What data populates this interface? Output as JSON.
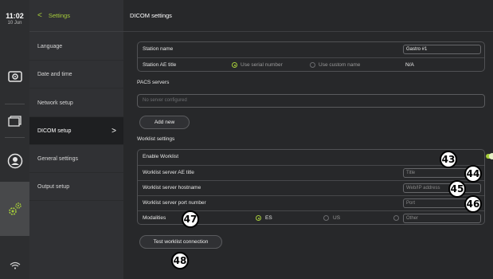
{
  "status": {
    "time": "11:02",
    "date": "10 Jun"
  },
  "rail": {
    "icons": [
      "monitor-icon",
      "folder-icon",
      "user-icon",
      "settings-gear-icon",
      "wifi-icon"
    ],
    "active": "settings-gear-icon",
    "accent": "#a6cc3a"
  },
  "menu": {
    "back_label": "<",
    "title": "Settings",
    "items": [
      {
        "label": "Language"
      },
      {
        "label": "Date and time"
      },
      {
        "label": "Network setup"
      },
      {
        "label": "DICOM setup",
        "chevron": ">"
      },
      {
        "label": "General settings"
      },
      {
        "label": "Output setup"
      }
    ],
    "active_item": "DICOM setup"
  },
  "main": {
    "title": "DICOM settings",
    "station": {
      "name_label": "Station name",
      "name_value": "Gastro #1",
      "ae_label": "Station AE title",
      "option_serial": "Use serial number",
      "option_custom": "Use custom name",
      "selected_option": "Use serial number",
      "ae_value": "N/A"
    },
    "pacs": {
      "title": "PACS servers",
      "placeholder": "No server configured",
      "add_button": "Add new"
    },
    "worklist": {
      "title": "Worklist settings",
      "enable_label": "Enable Worklist",
      "enabled": true,
      "ae_label": "Worklist server AE title",
      "ae_placeholder": "Title",
      "host_label": "Worklist server hostname",
      "host_placeholder": "Web/IP address",
      "port_label": "Worklist server port number",
      "port_placeholder": "Port",
      "modalities_label": "Modalities",
      "modality_es": "ES",
      "modality_us": "US",
      "modality_other_placeholder": "Other",
      "selected_modality": "ES",
      "test_button": "Test worklist connection"
    }
  },
  "callouts": [
    "43",
    "44",
    "45",
    "46",
    "47",
    "48"
  ]
}
